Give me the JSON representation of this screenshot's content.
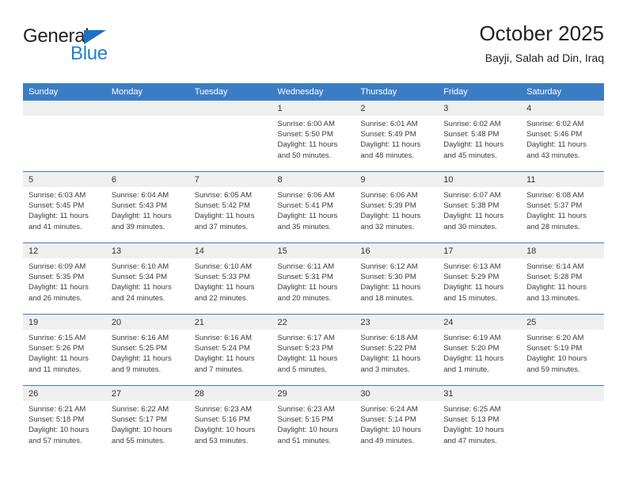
{
  "brand": {
    "name_part1": "General",
    "name_part2": "Blue",
    "accent_color": "#1f7fd4",
    "triangle_color": "#1f6fc4"
  },
  "header": {
    "title": "October 2025",
    "subtitle": "Bayji, Salah ad Din, Iraq"
  },
  "colors": {
    "header_row_bg": "#3b7dc4",
    "daynum_band_bg": "#efefef",
    "row_divider": "#3b7dc4",
    "text": "#3b3b3b"
  },
  "weekdays": [
    "Sunday",
    "Monday",
    "Tuesday",
    "Wednesday",
    "Thursday",
    "Friday",
    "Saturday"
  ],
  "weeks": [
    [
      {
        "day": "",
        "sunrise": "",
        "sunset": "",
        "daylight1": "",
        "daylight2": ""
      },
      {
        "day": "",
        "sunrise": "",
        "sunset": "",
        "daylight1": "",
        "daylight2": ""
      },
      {
        "day": "",
        "sunrise": "",
        "sunset": "",
        "daylight1": "",
        "daylight2": ""
      },
      {
        "day": "1",
        "sunrise": "Sunrise: 6:00 AM",
        "sunset": "Sunset: 5:50 PM",
        "daylight1": "Daylight: 11 hours",
        "daylight2": "and 50 minutes."
      },
      {
        "day": "2",
        "sunrise": "Sunrise: 6:01 AM",
        "sunset": "Sunset: 5:49 PM",
        "daylight1": "Daylight: 11 hours",
        "daylight2": "and 48 minutes."
      },
      {
        "day": "3",
        "sunrise": "Sunrise: 6:02 AM",
        "sunset": "Sunset: 5:48 PM",
        "daylight1": "Daylight: 11 hours",
        "daylight2": "and 45 minutes."
      },
      {
        "day": "4",
        "sunrise": "Sunrise: 6:02 AM",
        "sunset": "Sunset: 5:46 PM",
        "daylight1": "Daylight: 11 hours",
        "daylight2": "and 43 minutes."
      }
    ],
    [
      {
        "day": "5",
        "sunrise": "Sunrise: 6:03 AM",
        "sunset": "Sunset: 5:45 PM",
        "daylight1": "Daylight: 11 hours",
        "daylight2": "and 41 minutes."
      },
      {
        "day": "6",
        "sunrise": "Sunrise: 6:04 AM",
        "sunset": "Sunset: 5:43 PM",
        "daylight1": "Daylight: 11 hours",
        "daylight2": "and 39 minutes."
      },
      {
        "day": "7",
        "sunrise": "Sunrise: 6:05 AM",
        "sunset": "Sunset: 5:42 PM",
        "daylight1": "Daylight: 11 hours",
        "daylight2": "and 37 minutes."
      },
      {
        "day": "8",
        "sunrise": "Sunrise: 6:06 AM",
        "sunset": "Sunset: 5:41 PM",
        "daylight1": "Daylight: 11 hours",
        "daylight2": "and 35 minutes."
      },
      {
        "day": "9",
        "sunrise": "Sunrise: 6:06 AM",
        "sunset": "Sunset: 5:39 PM",
        "daylight1": "Daylight: 11 hours",
        "daylight2": "and 32 minutes."
      },
      {
        "day": "10",
        "sunrise": "Sunrise: 6:07 AM",
        "sunset": "Sunset: 5:38 PM",
        "daylight1": "Daylight: 11 hours",
        "daylight2": "and 30 minutes."
      },
      {
        "day": "11",
        "sunrise": "Sunrise: 6:08 AM",
        "sunset": "Sunset: 5:37 PM",
        "daylight1": "Daylight: 11 hours",
        "daylight2": "and 28 minutes."
      }
    ],
    [
      {
        "day": "12",
        "sunrise": "Sunrise: 6:09 AM",
        "sunset": "Sunset: 5:35 PM",
        "daylight1": "Daylight: 11 hours",
        "daylight2": "and 26 minutes."
      },
      {
        "day": "13",
        "sunrise": "Sunrise: 6:10 AM",
        "sunset": "Sunset: 5:34 PM",
        "daylight1": "Daylight: 11 hours",
        "daylight2": "and 24 minutes."
      },
      {
        "day": "14",
        "sunrise": "Sunrise: 6:10 AM",
        "sunset": "Sunset: 5:33 PM",
        "daylight1": "Daylight: 11 hours",
        "daylight2": "and 22 minutes."
      },
      {
        "day": "15",
        "sunrise": "Sunrise: 6:11 AM",
        "sunset": "Sunset: 5:31 PM",
        "daylight1": "Daylight: 11 hours",
        "daylight2": "and 20 minutes."
      },
      {
        "day": "16",
        "sunrise": "Sunrise: 6:12 AM",
        "sunset": "Sunset: 5:30 PM",
        "daylight1": "Daylight: 11 hours",
        "daylight2": "and 18 minutes."
      },
      {
        "day": "17",
        "sunrise": "Sunrise: 6:13 AM",
        "sunset": "Sunset: 5:29 PM",
        "daylight1": "Daylight: 11 hours",
        "daylight2": "and 15 minutes."
      },
      {
        "day": "18",
        "sunrise": "Sunrise: 6:14 AM",
        "sunset": "Sunset: 5:28 PM",
        "daylight1": "Daylight: 11 hours",
        "daylight2": "and 13 minutes."
      }
    ],
    [
      {
        "day": "19",
        "sunrise": "Sunrise: 6:15 AM",
        "sunset": "Sunset: 5:26 PM",
        "daylight1": "Daylight: 11 hours",
        "daylight2": "and 11 minutes."
      },
      {
        "day": "20",
        "sunrise": "Sunrise: 6:16 AM",
        "sunset": "Sunset: 5:25 PM",
        "daylight1": "Daylight: 11 hours",
        "daylight2": "and 9 minutes."
      },
      {
        "day": "21",
        "sunrise": "Sunrise: 6:16 AM",
        "sunset": "Sunset: 5:24 PM",
        "daylight1": "Daylight: 11 hours",
        "daylight2": "and 7 minutes."
      },
      {
        "day": "22",
        "sunrise": "Sunrise: 6:17 AM",
        "sunset": "Sunset: 5:23 PM",
        "daylight1": "Daylight: 11 hours",
        "daylight2": "and 5 minutes."
      },
      {
        "day": "23",
        "sunrise": "Sunrise: 6:18 AM",
        "sunset": "Sunset: 5:22 PM",
        "daylight1": "Daylight: 11 hours",
        "daylight2": "and 3 minutes."
      },
      {
        "day": "24",
        "sunrise": "Sunrise: 6:19 AM",
        "sunset": "Sunset: 5:20 PM",
        "daylight1": "Daylight: 11 hours",
        "daylight2": "and 1 minute."
      },
      {
        "day": "25",
        "sunrise": "Sunrise: 6:20 AM",
        "sunset": "Sunset: 5:19 PM",
        "daylight1": "Daylight: 10 hours",
        "daylight2": "and 59 minutes."
      }
    ],
    [
      {
        "day": "26",
        "sunrise": "Sunrise: 6:21 AM",
        "sunset": "Sunset: 5:18 PM",
        "daylight1": "Daylight: 10 hours",
        "daylight2": "and 57 minutes."
      },
      {
        "day": "27",
        "sunrise": "Sunrise: 6:22 AM",
        "sunset": "Sunset: 5:17 PM",
        "daylight1": "Daylight: 10 hours",
        "daylight2": "and 55 minutes."
      },
      {
        "day": "28",
        "sunrise": "Sunrise: 6:23 AM",
        "sunset": "Sunset: 5:16 PM",
        "daylight1": "Daylight: 10 hours",
        "daylight2": "and 53 minutes."
      },
      {
        "day": "29",
        "sunrise": "Sunrise: 6:23 AM",
        "sunset": "Sunset: 5:15 PM",
        "daylight1": "Daylight: 10 hours",
        "daylight2": "and 51 minutes."
      },
      {
        "day": "30",
        "sunrise": "Sunrise: 6:24 AM",
        "sunset": "Sunset: 5:14 PM",
        "daylight1": "Daylight: 10 hours",
        "daylight2": "and 49 minutes."
      },
      {
        "day": "31",
        "sunrise": "Sunrise: 6:25 AM",
        "sunset": "Sunset: 5:13 PM",
        "daylight1": "Daylight: 10 hours",
        "daylight2": "and 47 minutes."
      },
      {
        "day": "",
        "sunrise": "",
        "sunset": "",
        "daylight1": "",
        "daylight2": ""
      }
    ]
  ]
}
